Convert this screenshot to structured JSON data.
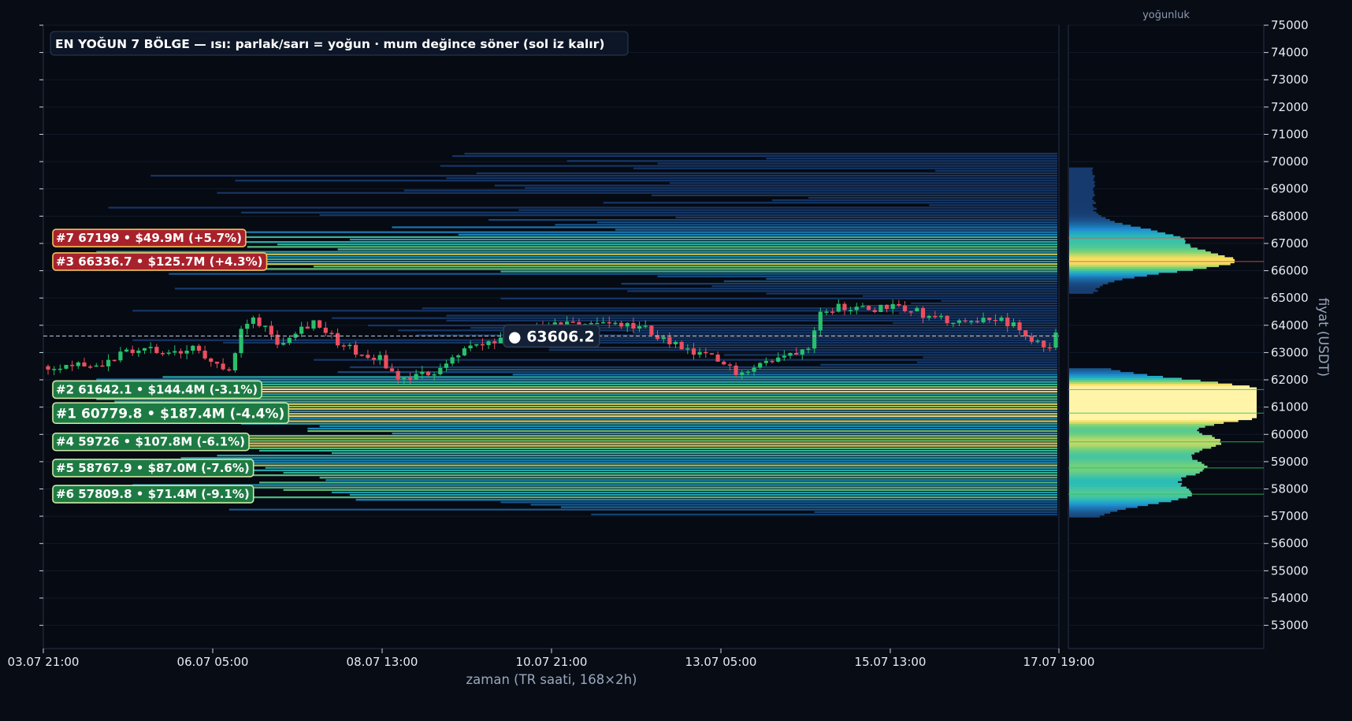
{
  "chart_data": {
    "type": "heatmap",
    "title": "EN YOĞUN 7 BÖLGE — ısı: parlak/sarı = yoğun · mum değince söner (sol iz kalır)",
    "xlabel": "zaman (TR saati, 168×2h)",
    "ylabel": "fiyat (USDT)",
    "profile_label": "yoğunluk",
    "x_ticks": [
      "03.07 21:00",
      "06.07 05:00",
      "08.07 13:00",
      "10.07 21:00",
      "13.07 05:00",
      "15.07 13:00",
      "17.07 19:00"
    ],
    "y_ticks": [
      53000,
      54000,
      55000,
      56000,
      57000,
      58000,
      59000,
      60000,
      61000,
      62000,
      63000,
      64000,
      65000,
      66000,
      67000,
      68000,
      69000,
      70000,
      71000,
      72000,
      73000,
      74000,
      75000
    ],
    "ylim": [
      52150,
      75000
    ],
    "n_candles": 168,
    "current_price": 63606.2,
    "current_price_label": "● 63606.2",
    "zones": [
      {
        "rank": 7,
        "price": 67199,
        "label": "#7  67199  •  $49.9M  (+5.7%)",
        "side": "above"
      },
      {
        "rank": 3,
        "price": 66336.7,
        "label": "#3  66336.7  •  $125.7M  (+4.3%)",
        "side": "above"
      },
      {
        "rank": 2,
        "price": 61642.1,
        "label": "#2  61642.1  •  $144.4M  (-3.1%)",
        "side": "below"
      },
      {
        "rank": 1,
        "price": 60779.8,
        "label": "#1  60779.8  •  $187.4M  (-4.4%)",
        "side": "below"
      },
      {
        "rank": 4,
        "price": 59726,
        "label": "#4  59726  •  $107.8M  (-6.1%)",
        "side": "below"
      },
      {
        "rank": 5,
        "price": 58767.9,
        "label": "#5  58767.9  •  $87.0M  (-7.6%)",
        "side": "below"
      },
      {
        "rank": 6,
        "price": 57809.8,
        "label": "#6  57809.8  •  $71.4M  (-9.1%)",
        "side": "below"
      }
    ],
    "price_path": [
      [
        0,
        62500
      ],
      [
        4,
        62600
      ],
      [
        8,
        62550
      ],
      [
        12,
        62900
      ],
      [
        16,
        63150
      ],
      [
        20,
        62900
      ],
      [
        24,
        63100
      ],
      [
        28,
        62700
      ],
      [
        30,
        62200
      ],
      [
        32,
        63800
      ],
      [
        34,
        64200
      ],
      [
        36,
        64000
      ],
      [
        38,
        63300
      ],
      [
        40,
        63700
      ],
      [
        44,
        64150
      ],
      [
        48,
        63400
      ],
      [
        52,
        62900
      ],
      [
        55,
        62800
      ],
      [
        58,
        62000
      ],
      [
        61,
        62100
      ],
      [
        64,
        62300
      ],
      [
        67,
        62850
      ],
      [
        70,
        63200
      ],
      [
        74,
        63350
      ],
      [
        78,
        63550
      ],
      [
        82,
        63900
      ],
      [
        86,
        64000
      ],
      [
        90,
        64100
      ],
      [
        94,
        64000
      ],
      [
        98,
        63950
      ],
      [
        102,
        63500
      ],
      [
        106,
        63000
      ],
      [
        110,
        62800
      ],
      [
        114,
        62300
      ],
      [
        118,
        62600
      ],
      [
        122,
        62850
      ],
      [
        126,
        63300
      ],
      [
        128,
        64600
      ],
      [
        132,
        64700
      ],
      [
        136,
        64550
      ],
      [
        140,
        64800
      ],
      [
        144,
        64500
      ],
      [
        148,
        64200
      ],
      [
        152,
        64000
      ],
      [
        156,
        64300
      ],
      [
        160,
        64000
      ],
      [
        163,
        63300
      ],
      [
        166,
        63300
      ],
      [
        167,
        63600
      ]
    ],
    "colors": {
      "background": "#080d15",
      "up": "#27c06b",
      "down": "#ea4f5f",
      "zone_above": "#a8222c",
      "zone_below": "#1e7a43",
      "heat_low": "#173a6e",
      "heat_high": "#fff2a0"
    }
  }
}
